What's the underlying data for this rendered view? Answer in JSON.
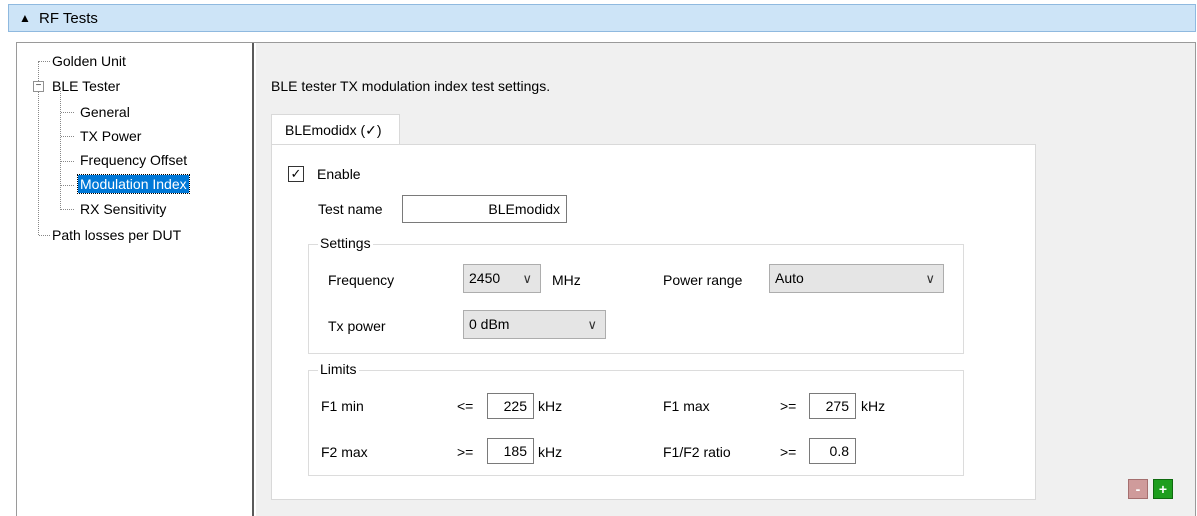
{
  "header": {
    "collapse_icon": "triangle-up-icon",
    "title": "RF Tests"
  },
  "tree": {
    "golden_unit": "Golden Unit",
    "ble_tester": "BLE Tester",
    "expand_icon": "minus-box-icon",
    "children": [
      "General",
      "TX Power",
      "Frequency Offset",
      "Modulation Index",
      "RX Sensitivity"
    ],
    "path_losses": "Path losses per DUT",
    "selected": "Modulation Index"
  },
  "description": "BLE tester TX modulation index test settings.",
  "tab": {
    "label": "BLEmodidx (✓)"
  },
  "enable": {
    "label": "Enable",
    "checked": true,
    "mark": "✓"
  },
  "test_name": {
    "label": "Test name",
    "value": "BLEmodidx"
  },
  "settings": {
    "title": "Settings",
    "frequency_label": "Frequency",
    "frequency_value": "2450",
    "frequency_unit": "MHz",
    "power_range_label": "Power range",
    "power_range_value": "Auto",
    "tx_power_label": "Tx power",
    "tx_power_value": "0 dBm",
    "chevron": "∨"
  },
  "limits": {
    "title": "Limits",
    "f1min_label": "F1 min",
    "f1min_op": "<=",
    "f1min_value": "225",
    "f1min_unit": "kHz",
    "f1max_label": "F1 max",
    "f1max_op": ">=",
    "f1max_value": "275",
    "f1max_unit": "kHz",
    "f2max_label": "F2 max",
    "f2max_op": ">=",
    "f2max_value": "185",
    "f2max_unit": "kHz",
    "ratio_label": "F1/F2 ratio",
    "ratio_op": ">=",
    "ratio_value": "0.8"
  },
  "buttons": {
    "remove": "-",
    "add": "+"
  },
  "colors": {
    "header_bg": "#cde4f7",
    "selection": "#0078d7",
    "remove_btn": "#cf9b9b",
    "add_btn": "#1e9e1e"
  }
}
